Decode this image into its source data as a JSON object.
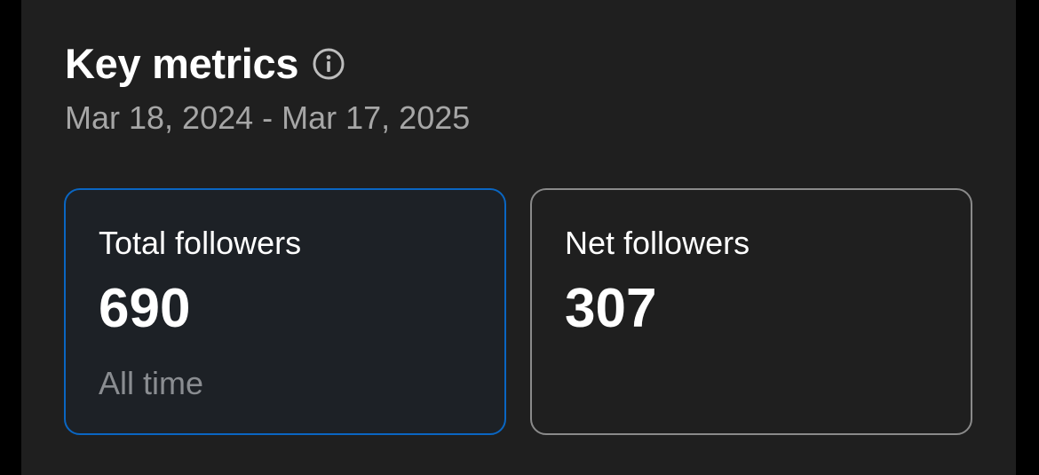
{
  "header": {
    "title": "Key metrics",
    "info_icon": "info-circle-icon",
    "date_range": "Mar 18, 2024 - Mar 17, 2025"
  },
  "cards": [
    {
      "label": "Total followers",
      "value": "690",
      "subtext": "All time",
      "selected": true
    },
    {
      "label": "Net followers",
      "value": "307",
      "subtext": "",
      "selected": false
    }
  ],
  "colors": {
    "background": "#1f1f1f",
    "selected_border": "#0a66c2",
    "card_border": "#8a8a8a",
    "text_primary": "#ffffff",
    "text_secondary": "#a6a6a6"
  }
}
